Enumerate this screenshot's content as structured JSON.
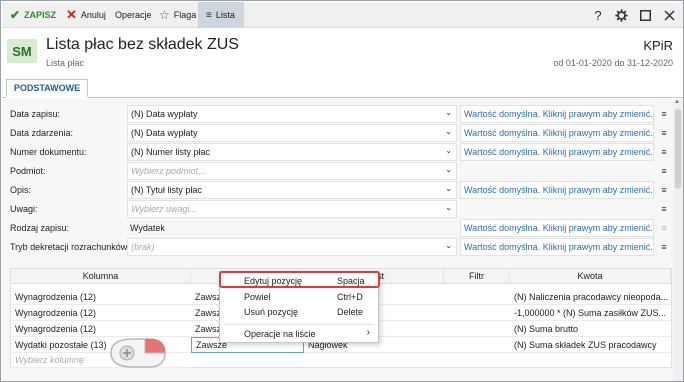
{
  "toolbar": {
    "save": "ZAPISZ",
    "cancel": "Anuluj",
    "operations": "Operacje",
    "flag": "Flaga",
    "list": "Lista",
    "help": "?",
    "settings_icon": "gear-icon",
    "maximize_icon": "maximize-icon",
    "close_icon": "close-icon"
  },
  "header": {
    "badge": "SM",
    "title": "Lista płac bez składek ZUS",
    "subtitle": "Lista płac",
    "company": "KPiR",
    "period": "od 01-01-2020 do 31-12-2020"
  },
  "tab": {
    "label": "PODSTAWOWE"
  },
  "colors": {
    "accent": "#1f5f9e",
    "save_green": "#2d8a2d",
    "cancel_red": "#d32020",
    "hint_blue": "#2a6db3",
    "highlight_red": "#e03a3a"
  },
  "form": {
    "rows": [
      {
        "label": "Data zapisu:",
        "value": "(N) Data wypłaty",
        "hint": "Wartość domyślna. Kliknij prawym aby zmienić."
      },
      {
        "label": "Data zdarzenia:",
        "value": "(N) Data wypłaty",
        "hint": "Wartość domyślna. Kliknij prawym aby zmienić."
      },
      {
        "label": "Numer dokumentu:",
        "value": "(N) Numer listy płac",
        "hint": "Wartość domyślna. Kliknij prawym aby zmienić."
      },
      {
        "label": "Podmiot:",
        "placeholder": "Wybierz podmiot..."
      },
      {
        "label": "Opis:",
        "value": "(N) Tytuł listy płac",
        "hint": "Wartość domyślna. Kliknij prawym aby zmienić."
      },
      {
        "label": "Uwagi:",
        "placeholder": "Wybierz uwagi..."
      },
      {
        "label": "Rodzaj zapisu:",
        "value": "Wydatek",
        "hint": "Wartość domyślna. Kliknij prawym aby zmienić."
      },
      {
        "label": "Tryb dekretacji rozrachunków:",
        "placeholder": "(brak)",
        "hint": "Wartość domyślna. Kliknij prawym aby zmienić."
      }
    ]
  },
  "table": {
    "columns": [
      "Kolumna",
      "Tekst",
      "Filtr",
      "Kwota"
    ],
    "rows": [
      {
        "kolumna": "Wynagrodzenia (12)",
        "warunek": "Zawsz",
        "tekst": "",
        "filtr": "",
        "kwota": "(N) Naliczenia pracodawcy nieopoda..."
      },
      {
        "kolumna": "Wynagrodzenia (12)",
        "warunek": "Zawsz",
        "tekst": "",
        "filtr": "",
        "kwota": "-1,000000 * (N) Suma zasiłków ZUS..."
      },
      {
        "kolumna": "Wynagrodzenia (12)",
        "warunek": "Zawsz",
        "tekst": "",
        "filtr": "",
        "kwota": "(N) Suma brutto"
      },
      {
        "kolumna": "Wydatki pozostałe (13)",
        "warunek": "Zawsze",
        "tekst": "Nagłówek",
        "filtr": "",
        "kwota": "(N) Suma składek ZUS pracodawcy"
      }
    ],
    "add_placeholder": "Wybierz kolumnę"
  },
  "context_menu": {
    "items": [
      {
        "label": "Edytuj pozycję",
        "shortcut": "Spacja"
      },
      {
        "label": "Powiel",
        "shortcut": "Ctrl+D"
      },
      {
        "label": "Usuń pozycję",
        "shortcut": "Delete"
      },
      {
        "label": "Operacje na liście",
        "shortcut": ""
      }
    ]
  }
}
